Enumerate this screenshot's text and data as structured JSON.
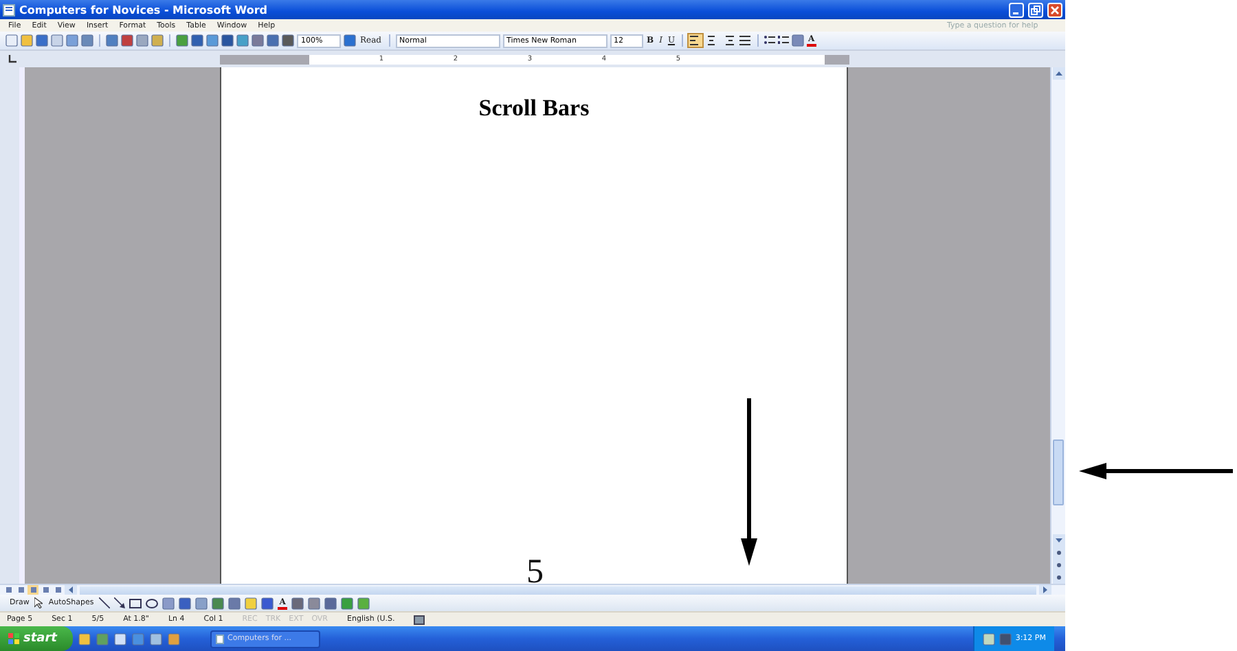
{
  "window": {
    "title": "Computers for Novices - Microsoft Word"
  },
  "menu_bar": {
    "items": [
      "File",
      "Edit",
      "View",
      "Insert",
      "Format",
      "Tools",
      "Table",
      "Window",
      "Help"
    ],
    "help_field": {
      "placeholder": "Type a question for help"
    }
  },
  "toolbar": {
    "zoom": "100%",
    "read_button": "Read",
    "style": "Normal",
    "font": "Times New Roman",
    "font_size": "12",
    "format_buttons": [
      {
        "label": "B",
        "selected": false
      },
      {
        "label": "I",
        "selected": false
      },
      {
        "label": "U",
        "selected": false
      }
    ],
    "alignment_buttons": [
      {
        "selected": true
      },
      {
        "selected": false
      },
      {
        "selected": false
      },
      {
        "selected": false
      }
    ],
    "font_color_button": "A"
  },
  "ruler": {
    "marks": [
      "1",
      "2",
      "3",
      "4",
      "5"
    ]
  },
  "document": {
    "heading": "Scroll Bars"
  },
  "view_buttons": [
    {
      "selected": false
    },
    {
      "selected": false
    },
    {
      "selected": true
    },
    {
      "selected": false
    },
    {
      "selected": false
    }
  ],
  "drawing_toolbar": {
    "draw_menu": "Draw",
    "autoshapes_menu": "AutoShapes",
    "font_color_button": "A"
  },
  "status_bar": {
    "page": "Page 5",
    "section": "Sec 1",
    "pages": "5/5",
    "position": "At 1.8\"",
    "line": "Ln 4",
    "column": "Col 1",
    "modes": [
      {
        "label": "REC",
        "on": false
      },
      {
        "label": "TRK",
        "on": false
      },
      {
        "label": "EXT",
        "on": false
      },
      {
        "label": "OVR",
        "on": false
      }
    ],
    "language": "English (U.S."
  },
  "taskbar": {
    "start": "start",
    "task": "Computers for ...",
    "clock": "3:12 PM"
  },
  "annotation": {
    "page_number": "5"
  }
}
